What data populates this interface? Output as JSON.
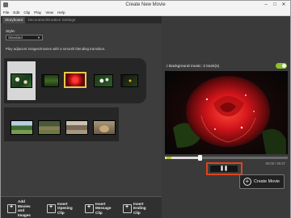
{
  "window": {
    "title": "Create New Movie",
    "controls": {
      "minimize": "–",
      "maximize": "□",
      "close": "✕"
    }
  },
  "menu": [
    "File",
    "Edit",
    "Clip",
    "Play",
    "View",
    "Help"
  ],
  "tabs": [
    {
      "label": "Storyboard",
      "active": true
    },
    {
      "label": "Decoration/Duration Settings",
      "active": false
    }
  ],
  "style": {
    "label": "Style:",
    "selected": "Standard",
    "description": "Play adjacent images/movies with a smooth blending transition."
  },
  "storyboard": {
    "row1_thumbs": [
      "lilies",
      "grass",
      "red-rose",
      "white-flowers",
      "dark-flowers"
    ],
    "row2_thumbs": [
      "trees",
      "deer",
      "house",
      "dog"
    ],
    "selected_index": 2
  },
  "toolbar": {
    "buttons": [
      {
        "name": "add-movies-images",
        "line1": "Add Movies",
        "line2": "and Images"
      },
      {
        "name": "insert-opening-clip",
        "line1": "Insert Opening",
        "line2": "Clip"
      },
      {
        "name": "insert-message-clip",
        "line1": "Insert Message",
        "line2": "Clip"
      },
      {
        "name": "insert-ending-clip",
        "line1": "Insert Ending",
        "line2": "Clip"
      }
    ]
  },
  "music": {
    "label": "Background music: 3 track(s)",
    "enabled": true
  },
  "player": {
    "time": "00:00 / 00:47",
    "progress": 0.28,
    "pause_symbol": "❚❚"
  },
  "create": {
    "label": "Create Movie"
  },
  "colors": {
    "accent_green": "#8dbf2e",
    "highlight_red": "#e0421d",
    "rose": "#c8141a"
  }
}
